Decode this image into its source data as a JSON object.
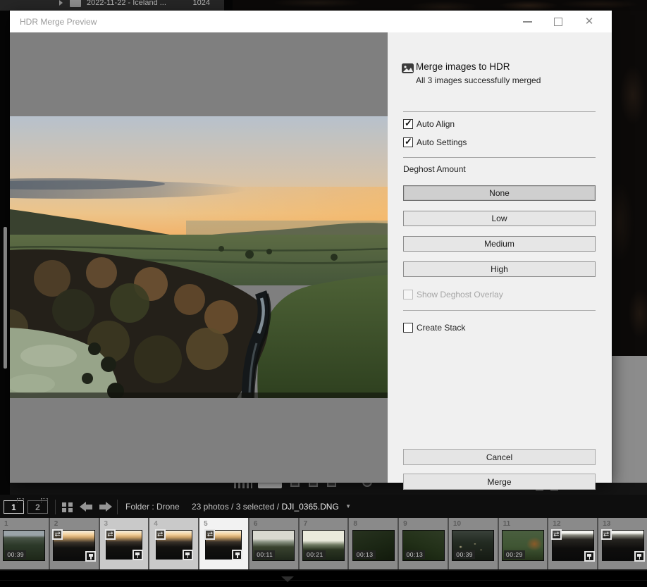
{
  "background": {
    "folder_row": {
      "name": "2022-11-22 - Iceland ...",
      "count": "1024"
    }
  },
  "dialog": {
    "title": "HDR Merge Preview",
    "header": {
      "title": "Merge images to HDR",
      "subtitle": "All 3 images successfully merged"
    },
    "options": [
      {
        "label": "Auto Align",
        "checked": true
      },
      {
        "label": "Auto Settings",
        "checked": true
      }
    ],
    "deghost": {
      "label": "Deghost Amount",
      "levels": [
        {
          "label": "None",
          "selected": true
        },
        {
          "label": "Low",
          "selected": false
        },
        {
          "label": "Medium",
          "selected": false
        },
        {
          "label": "High",
          "selected": false
        }
      ]
    },
    "overlay_option": {
      "label": "Show Deghost Overlay",
      "checked": false,
      "disabled": true
    },
    "stack_option": {
      "label": "Create Stack",
      "checked": false
    },
    "actions": {
      "cancel": "Cancel",
      "merge": "Merge"
    }
  },
  "toolbar": {
    "screen1": "1",
    "screen2": "2",
    "folder_label": "Folder : Drone",
    "status": "23 photos / 3 selected /",
    "filename": "DJI_0365.DNG"
  },
  "filmstrip": {
    "items": [
      {
        "index": "1",
        "type": "video",
        "duration": "00:39",
        "state": "normal"
      },
      {
        "index": "2",
        "type": "photo",
        "state": "normal"
      },
      {
        "index": "3",
        "type": "photo",
        "state": "selected"
      },
      {
        "index": "4",
        "type": "photo",
        "state": "selected"
      },
      {
        "index": "5",
        "type": "photo",
        "state": "active"
      },
      {
        "index": "6",
        "type": "video",
        "duration": "00:11",
        "state": "normal"
      },
      {
        "index": "7",
        "type": "video",
        "duration": "00:21",
        "state": "normal"
      },
      {
        "index": "8",
        "type": "video",
        "duration": "00:13",
        "state": "normal"
      },
      {
        "index": "9",
        "type": "video",
        "duration": "00:13",
        "state": "normal"
      },
      {
        "index": "10",
        "type": "video",
        "duration": "00:39",
        "state": "normal"
      },
      {
        "index": "11",
        "type": "video",
        "duration": "00:29",
        "state": "normal"
      },
      {
        "index": "12",
        "type": "photo",
        "state": "normal"
      },
      {
        "index": "13",
        "type": "photo",
        "state": "normal"
      }
    ]
  },
  "icons": {
    "close_glyph": "✕",
    "check_glyph": "✓",
    "caret_down_glyph": "▼",
    "sync_glyph": "⇄",
    "zigzag_glyph": "∨∨"
  },
  "colors": {
    "panel_bg": "#f0f0f0",
    "preview_bg": "#7f7f7f",
    "selected_button_bg": "#cfcfcf",
    "filmstrip_active_bg": "#f2f2f2",
    "filmstrip_selected_bg": "#c9c9c9"
  }
}
